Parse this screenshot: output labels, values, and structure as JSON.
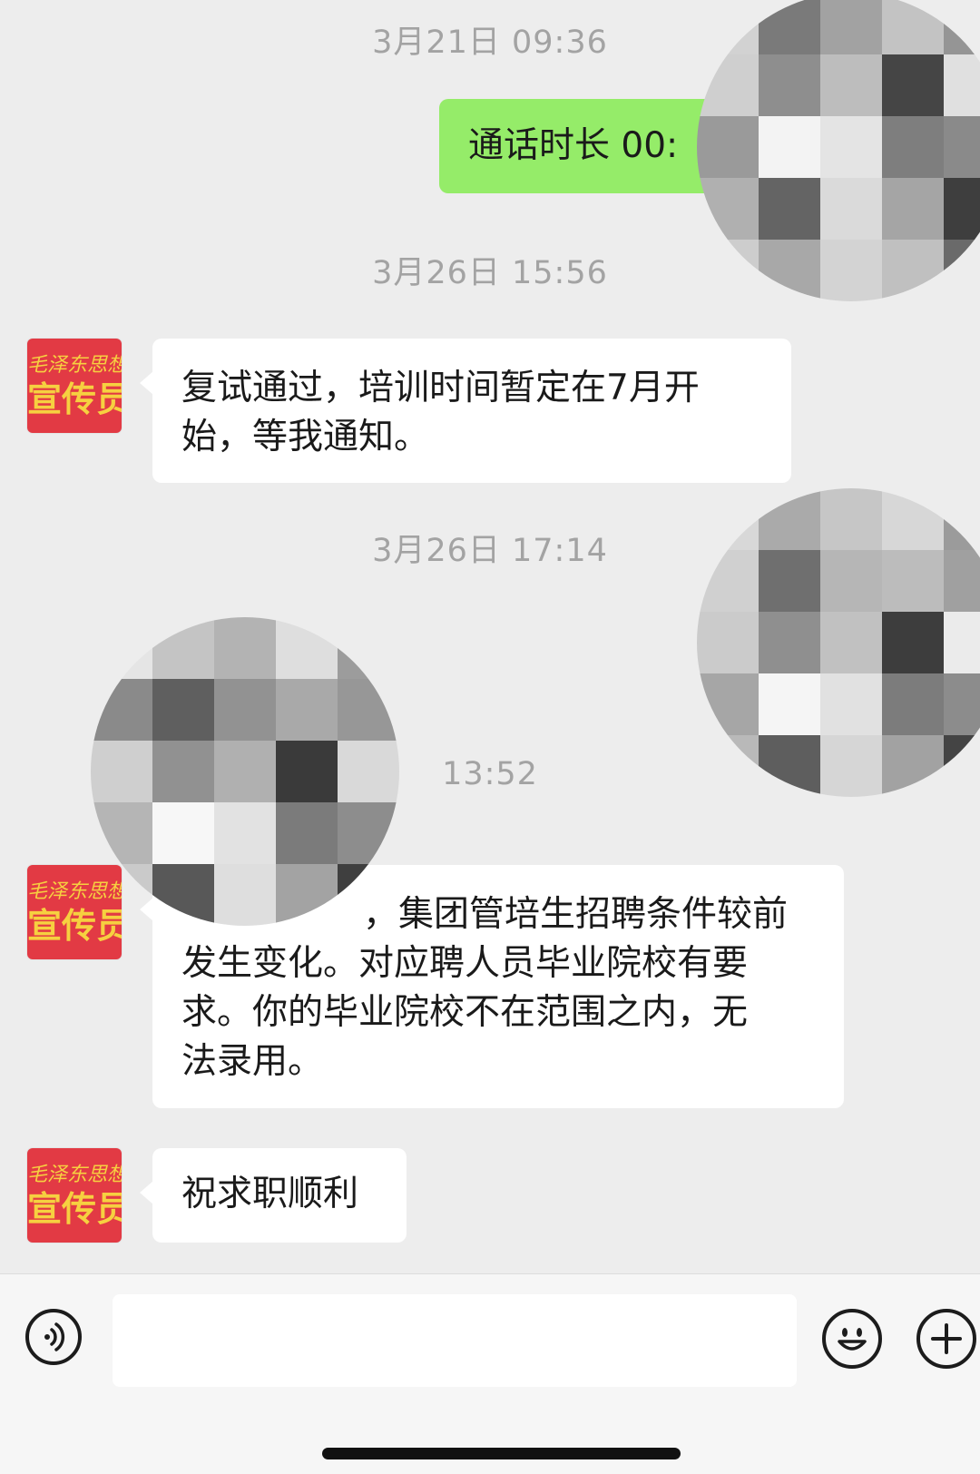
{
  "timestamps": [
    "3月21日 09:36",
    "3月26日 15:56",
    "3月26日 17:14",
    "13:52"
  ],
  "outgoing": {
    "call_text": "通话时长 00:"
  },
  "avatar": {
    "line1": "毛泽东思想",
    "line2": "宣传员"
  },
  "messages": [
    {
      "lines": [
        "复试通过，培训时间暂定在7月开",
        "始，等我通知。"
      ]
    },
    {
      "lines": [
        "，集团管培生招聘条件较前",
        "发生变化。对应聘人员毕业院校有要",
        "求。你的毕业院校不在范围之内，无",
        "法录用。"
      ]
    },
    {
      "lines": [
        "祝求职顺利"
      ]
    }
  ],
  "input_bar": {
    "voice_icon": "voice-icon",
    "emoji_icon": "emoji-icon",
    "plus_icon": "plus-icon",
    "text_value": ""
  },
  "colors": {
    "background": "#ededed",
    "outgoing_bubble": "#95ec69",
    "incoming_bubble": "#ffffff",
    "avatar_bg": "#e23a44",
    "avatar_text": "#f6d040",
    "timestamp": "#a3a3a3"
  }
}
